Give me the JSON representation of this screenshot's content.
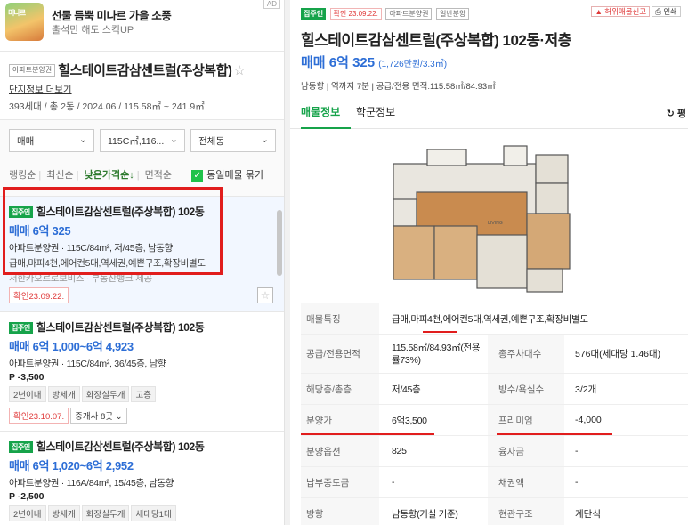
{
  "ad": {
    "thumb_text": "미나르",
    "title": "선물 듬뿍 미나르 가을 소풍",
    "subtitle": "출석만 해도 스킥UP",
    "badge": "AD"
  },
  "complex": {
    "tag": "아파트분양권",
    "name": "힐스테이트감삼센트럴(주상복합)",
    "star": "☆",
    "link": "단지정보 더보기",
    "meta": "393세대 / 총 2동 / 2024.06 / 115.58㎡ ~ 241.9㎡"
  },
  "filters": {
    "selects": [
      "매매",
      "115C㎡,116...",
      "전체동"
    ],
    "sort": [
      "랭킹순",
      "최신순",
      "낮은가격순↓",
      "면적순"
    ],
    "same_listing": "동일매물 묶기"
  },
  "listings": [
    {
      "tag": "집주인",
      "name": "힐스테이트감삼센트럴(주상복합) 102동",
      "price": "매매 6억 325",
      "spec": "아파트분양권 · 115C/84m², 저/45층, 남동향",
      "desc": "급매,마피4천,에어컨5대,역세권,예쁜구조,확장비별도",
      "desc2": "서한카오르로보비스 · 부동산뱅크 제공",
      "confirm": "확인23.09.22."
    },
    {
      "tag": "집주인",
      "name": "힐스테이트감삼센트럴(주상복합) 102동",
      "price": "매매 6억 1,000~6억 4,923",
      "spec": "아파트분양권 · 115C/84m², 36/45층, 남향",
      "premium": "P -3,500",
      "tags": [
        "2년이내",
        "방세개",
        "화장실두개",
        "고층"
      ],
      "confirm": "확인23.10.07.",
      "agency": "중개사 8곳 ⌄"
    },
    {
      "tag": "집주인",
      "name": "힐스테이트감삼센트럴(주상복합) 102동",
      "price": "매매 6억 1,020~6억 2,952",
      "spec": "아파트분양권 · 116A/84m², 15/45층, 남동향",
      "premium": "P -2,500",
      "tags": [
        "2년이내",
        "방세개",
        "화장실두개",
        "세대당1대"
      ]
    }
  ],
  "detail": {
    "tags": {
      "owner": "집주인",
      "confirm": "확인 23.09.22.",
      "type": "아파트분양권",
      "kind": "일반분양"
    },
    "report": "허위매물신고",
    "print": "인쇄",
    "title": "힐스테이트감삼센트럴(주상복합) 102동·저층",
    "price": "매매 6억 325",
    "price_per": "(1,726만원/3.3㎡)",
    "sub": "남동향 | 역까지 7분 | 공급/전용 면적:115.58㎡/84.93㎡",
    "tabs": [
      "매물정보",
      "학군정보"
    ],
    "tab_right": "↻ 평",
    "rows": [
      {
        "l1": "매물특징",
        "v1": "급매,마피4천,에어컨5대,역세권,예쁜구조,확장비별도"
      },
      {
        "l1": "공급/전용면적",
        "v1": "115.58㎡/84.93㎡(전용률73%)",
        "l2": "총주차대수",
        "v2": "576대(세대당 1.46대)"
      },
      {
        "l1": "해당층/총층",
        "v1": "저/45층",
        "l2": "방수/욕실수",
        "v2": "3/2개"
      },
      {
        "l1": "분양가",
        "v1": "6억3,500",
        "l2": "프리미엄",
        "v2": "-4,000"
      },
      {
        "l1": "분양옵션",
        "v1": "825",
        "l2": "융자금",
        "v2": "-"
      },
      {
        "l1": "납부중도금",
        "v1": "-",
        "l2": "채권액",
        "v2": "-"
      },
      {
        "l1": "방향",
        "v1": "남동향(거실 기준)",
        "l2": "현관구조",
        "v2": "계단식"
      }
    ]
  },
  "colors": {
    "accent_green": "#16a34a",
    "price_blue": "#2d6ed6",
    "highlight_red": "#e11d1d"
  }
}
